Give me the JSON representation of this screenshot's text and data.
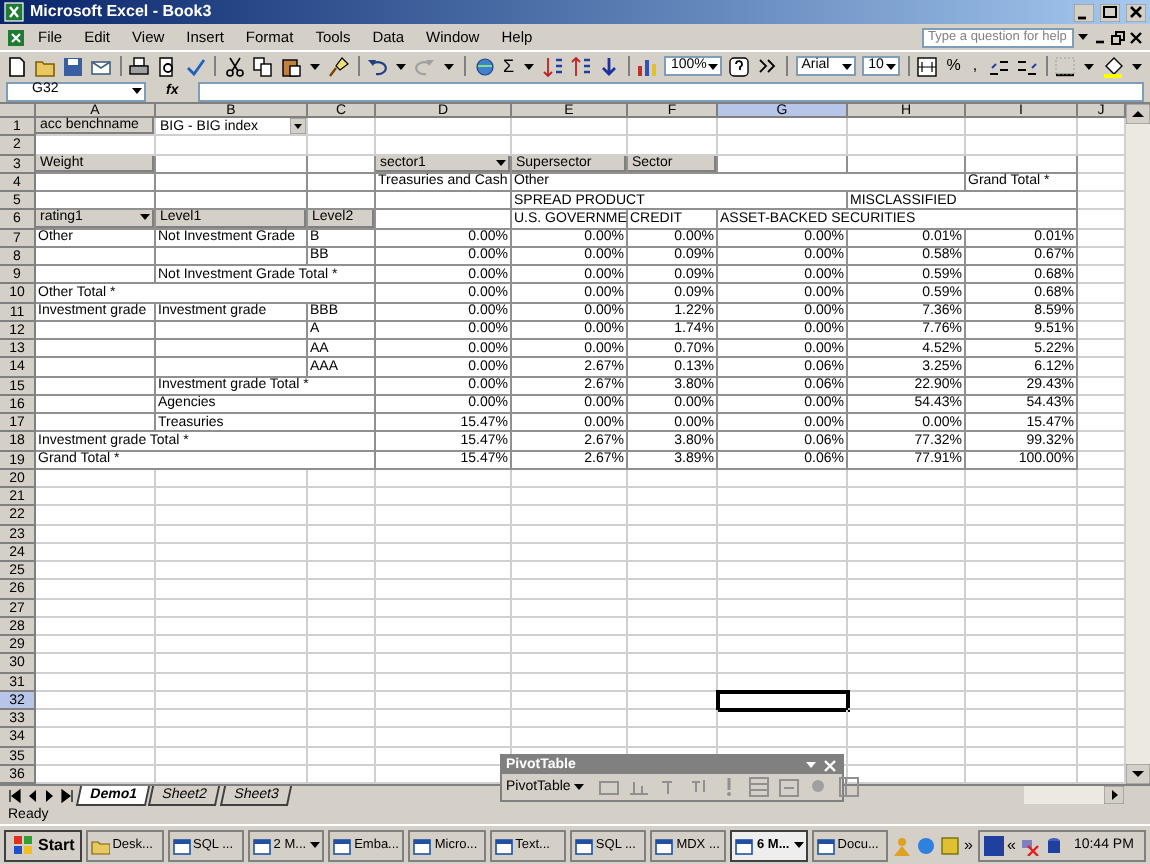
{
  "window": {
    "title": "Microsoft Excel - Book3"
  },
  "menu": [
    "File",
    "Edit",
    "View",
    "Insert",
    "Format",
    "Tools",
    "Data",
    "Window",
    "Help"
  ],
  "help_search": {
    "placeholder": "Type a question for help"
  },
  "toolbar": {
    "autosum": "Σ",
    "zoom": "100%",
    "font": "Arial",
    "font_size": "10",
    "percent": "%",
    "comma": ","
  },
  "formula_bar": {
    "name_box": "G32",
    "function_label": "fx"
  },
  "columns": [
    {
      "label": "A",
      "selected": false
    },
    {
      "label": "B",
      "selected": false
    },
    {
      "label": "C",
      "selected": false
    },
    {
      "label": "D",
      "selected": false
    },
    {
      "label": "E",
      "selected": false
    },
    {
      "label": "F",
      "selected": false
    },
    {
      "label": "G",
      "selected": true
    },
    {
      "label": "H",
      "selected": false
    },
    {
      "label": "I",
      "selected": false
    },
    {
      "label": "J",
      "selected": false
    }
  ],
  "rows": [
    {
      "number": "1",
      "selected": false,
      "cells": {
        "A": {
          "text": "acc benchname",
          "kind": "field",
          "dropdown": false
        },
        "B": {
          "text": "BIG - BIG index",
          "kind": "page_value",
          "dropdown": true
        }
      }
    },
    {
      "number": "2",
      "selected": false
    },
    {
      "number": "3",
      "selected": false,
      "cells": {
        "A": {
          "text": "Weight",
          "kind": "field",
          "dropdown": false
        },
        "D": {
          "text": "sector1",
          "kind": "field",
          "dropdown": true
        },
        "E": {
          "text": "Supersector",
          "kind": "field",
          "dropdown": false
        },
        "F": {
          "text": "Sector",
          "kind": "field",
          "dropdown": false
        }
      }
    },
    {
      "number": "4",
      "selected": false,
      "cells": {
        "D": {
          "text": "Treasuries and Cash",
          "kind": "text"
        },
        "E": {
          "text": "Other",
          "kind": "text"
        },
        "I": {
          "text": "Grand Total *",
          "kind": "text"
        }
      }
    },
    {
      "number": "5",
      "selected": false,
      "cells": {
        "E": {
          "text": "SPREAD PRODUCT",
          "kind": "text"
        },
        "H": {
          "text": "MISCLASSIFIED",
          "kind": "text"
        }
      }
    },
    {
      "number": "6",
      "selected": false,
      "cells": {
        "A": {
          "text": "rating1",
          "kind": "field",
          "dropdown": true
        },
        "B": {
          "text": "Level1",
          "kind": "field",
          "dropdown": false
        },
        "C": {
          "text": "Level2",
          "kind": "field",
          "dropdown": false
        },
        "E": {
          "text": "U.S. GOVERNME",
          "kind": "text"
        },
        "F": {
          "text": "CREDIT",
          "kind": "text"
        },
        "G": {
          "text": "ASSET-BACKED SECURITIES",
          "kind": "text"
        }
      }
    },
    {
      "number": "7",
      "selected": false,
      "cells": {
        "A": {
          "text": "Other",
          "kind": "text"
        },
        "B": {
          "text": "Not Investment Grade",
          "kind": "text"
        },
        "C": {
          "text": "B",
          "kind": "text"
        }
      },
      "values": [
        "0.00%",
        "0.00%",
        "0.00%",
        "0.00%",
        "0.01%",
        "0.01%"
      ]
    },
    {
      "number": "8",
      "selected": false,
      "cells": {
        "C": {
          "text": "BB",
          "kind": "text"
        }
      },
      "values": [
        "0.00%",
        "0.00%",
        "0.09%",
        "0.00%",
        "0.58%",
        "0.67%"
      ]
    },
    {
      "number": "9",
      "selected": false,
      "cells": {
        "B": {
          "text": "Not Investment Grade Total *",
          "kind": "text"
        }
      },
      "values": [
        "0.00%",
        "0.00%",
        "0.09%",
        "0.00%",
        "0.59%",
        "0.68%"
      ]
    },
    {
      "number": "10",
      "selected": false,
      "cells": {
        "A": {
          "text": "Other Total *",
          "kind": "text"
        }
      },
      "values": [
        "0.00%",
        "0.00%",
        "0.09%",
        "0.00%",
        "0.59%",
        "0.68%"
      ]
    },
    {
      "number": "11",
      "selected": false,
      "cells": {
        "A": {
          "text": "Investment grade",
          "kind": "text"
        },
        "B": {
          "text": "Investment grade",
          "kind": "text"
        },
        "C": {
          "text": "BBB",
          "kind": "text"
        }
      },
      "values": [
        "0.00%",
        "0.00%",
        "1.22%",
        "0.00%",
        "7.36%",
        "8.59%"
      ]
    },
    {
      "number": "12",
      "selected": false,
      "cells": {
        "C": {
          "text": "A",
          "kind": "text"
        }
      },
      "values": [
        "0.00%",
        "0.00%",
        "1.74%",
        "0.00%",
        "7.76%",
        "9.51%"
      ]
    },
    {
      "number": "13",
      "selected": false,
      "cells": {
        "C": {
          "text": "AA",
          "kind": "text"
        }
      },
      "values": [
        "0.00%",
        "0.00%",
        "0.70%",
        "0.00%",
        "4.52%",
        "5.22%"
      ]
    },
    {
      "number": "14",
      "selected": false,
      "cells": {
        "C": {
          "text": "AAA",
          "kind": "text"
        }
      },
      "values": [
        "0.00%",
        "2.67%",
        "0.13%",
        "0.06%",
        "3.25%",
        "6.12%"
      ]
    },
    {
      "number": "15",
      "selected": false,
      "cells": {
        "B": {
          "text": "Investment grade Total *",
          "kind": "text"
        }
      },
      "values": [
        "0.00%",
        "2.67%",
        "3.80%",
        "0.06%",
        "22.90%",
        "29.43%"
      ]
    },
    {
      "number": "16",
      "selected": false,
      "cells": {
        "B": {
          "text": "Agencies",
          "kind": "text"
        }
      },
      "values": [
        "0.00%",
        "0.00%",
        "0.00%",
        "0.00%",
        "54.43%",
        "54.43%"
      ]
    },
    {
      "number": "17",
      "selected": false,
      "cells": {
        "B": {
          "text": "Treasuries",
          "kind": "text"
        }
      },
      "values": [
        "15.47%",
        "0.00%",
        "0.00%",
        "0.00%",
        "0.00%",
        "15.47%"
      ]
    },
    {
      "number": "18",
      "selected": false,
      "cells": {
        "A": {
          "text": "Investment grade Total *",
          "kind": "text"
        }
      },
      "values": [
        "15.47%",
        "2.67%",
        "3.80%",
        "0.06%",
        "77.32%",
        "99.32%"
      ]
    },
    {
      "number": "19",
      "selected": false,
      "cells": {
        "A": {
          "text": "Grand Total *",
          "kind": "text"
        }
      },
      "values": [
        "15.47%",
        "2.67%",
        "3.89%",
        "0.06%",
        "77.91%",
        "100.00%"
      ]
    },
    {
      "number": "20",
      "selected": false
    },
    {
      "number": "21",
      "selected": false
    },
    {
      "number": "22",
      "selected": false
    },
    {
      "number": "23",
      "selected": false
    },
    {
      "number": "24",
      "selected": false
    },
    {
      "number": "25",
      "selected": false
    },
    {
      "number": "26",
      "selected": false
    },
    {
      "number": "27",
      "selected": false
    },
    {
      "number": "28",
      "selected": false
    },
    {
      "number": "29",
      "selected": false
    },
    {
      "number": "30",
      "selected": false
    },
    {
      "number": "31",
      "selected": false
    },
    {
      "number": "32",
      "selected": true
    },
    {
      "number": "33",
      "selected": false
    },
    {
      "number": "34",
      "selected": false
    },
    {
      "number": "35",
      "selected": false
    },
    {
      "number": "36",
      "selected": false
    }
  ],
  "sheet_tabs": [
    {
      "label": "Demo1",
      "selected": true
    },
    {
      "label": "Sheet2",
      "selected": false
    },
    {
      "label": "Sheet3",
      "selected": false
    }
  ],
  "status_bar": {
    "text": "Ready"
  },
  "pivot_toolbar": {
    "title": "PivotTable",
    "menu": "PivotTable"
  },
  "taskbar": {
    "start": "Start",
    "items": [
      {
        "label": "Desk...",
        "selected": false,
        "grouped": false
      },
      {
        "label": "SQL ...",
        "selected": false,
        "grouped": false
      },
      {
        "label": "2 M...",
        "selected": false,
        "grouped": true
      },
      {
        "label": "Emba...",
        "selected": false,
        "grouped": false
      },
      {
        "label": "Micro...",
        "selected": false,
        "grouped": false
      },
      {
        "label": "Text...",
        "selected": false,
        "grouped": false
      },
      {
        "label": "SQL ...",
        "selected": false,
        "grouped": false
      },
      {
        "label": "MDX ...",
        "selected": false,
        "grouped": false
      },
      {
        "label": "6 M...",
        "selected": true,
        "grouped": true
      },
      {
        "label": "Docu...",
        "selected": false,
        "grouped": false
      }
    ],
    "overflow": "»",
    "tray_expand": "«",
    "clock": "10:44 PM"
  }
}
